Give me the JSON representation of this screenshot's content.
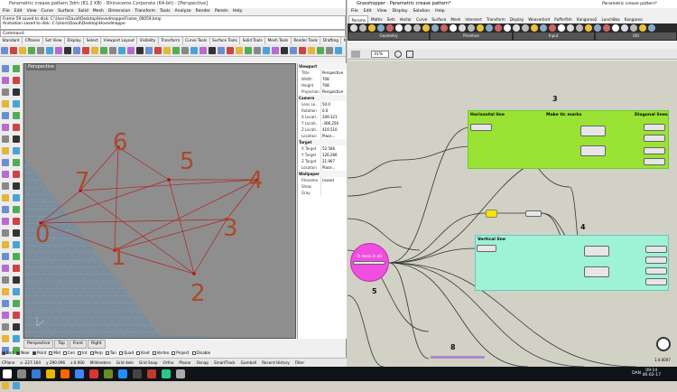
{
  "rhino": {
    "title": "Parametric crease pattern.3dm (81.2 KB) - Rhinoceros Corporate (64-bit) - [Perspective]",
    "menu": [
      "File",
      "Edit",
      "View",
      "Curve",
      "Surface",
      "Solid",
      "Mesh",
      "Dimension",
      "Transform",
      "Tools",
      "Analyze",
      "Render",
      "Panels",
      "Help"
    ],
    "command_history": [
      "Frame 59 saved to disk: C:\\Users\\David\\Desktop\\Hovedmappe\\Frame_00059.bmp",
      "Animation saved to disk: C:\\Users\\David\\Desktop\\Hovedmappe"
    ],
    "command_prompt": "Command:",
    "toolbar_tabs": [
      "Standard",
      "CPlanes",
      "Set View",
      "Display",
      "Select",
      "Viewport Layout",
      "Visibility",
      "Transform",
      "Curve Tools",
      "Surface Tools",
      "Solid Tools",
      "Mesh Tools",
      "Render Tools",
      "Drafting",
      "New in V6"
    ],
    "viewport_label": "Perspective",
    "point_labels": [
      "0",
      "1",
      "2",
      "3",
      "4",
      "5",
      "6",
      "7"
    ],
    "viewport_tabs": [
      "Perspective",
      "Top",
      "Front",
      "Right"
    ],
    "properties": {
      "viewport_header": "Viewport",
      "viewport_rows": [
        {
          "k": "Title",
          "v": "Perspective"
        },
        {
          "k": "Width",
          "v": "708"
        },
        {
          "k": "Height",
          "v": "708"
        },
        {
          "k": "Projection",
          "v": "Perspective"
        }
      ],
      "camera_header": "Camera",
      "camera_rows": [
        {
          "k": "Lens Le..",
          "v": "50.0"
        },
        {
          "k": "Rotation",
          "v": "0.0"
        },
        {
          "k": "X Locati..",
          "v": "349.321"
        },
        {
          "k": "Y Locati..",
          "v": "-306.256"
        },
        {
          "k": "Z Locati..",
          "v": "419.510"
        },
        {
          "k": "Location",
          "v": "Place..."
        }
      ],
      "target_header": "Target",
      "target_rows": [
        {
          "k": "X Target",
          "v": "52.566"
        },
        {
          "k": "Y Target",
          "v": "126.266"
        },
        {
          "k": "Z Target",
          "v": "21.907"
        },
        {
          "k": "Location",
          "v": "Place..."
        }
      ],
      "wallpaper_header": "Wallpaper",
      "wallpaper_rows": [
        {
          "k": "Filename",
          "v": "(none)"
        },
        {
          "k": "Show",
          "v": ""
        },
        {
          "k": "Gray",
          "v": ""
        }
      ]
    },
    "osnaps": [
      "End",
      "Near",
      "Point",
      "Mid",
      "Cen",
      "Int",
      "Perp",
      "Tan",
      "Quad",
      "Knot",
      "Vertex",
      "Project",
      "Disable"
    ],
    "status": [
      "CPlane",
      "x -227.164",
      "y 290.096",
      "z 0.000",
      "Millimeters",
      "Grid dele",
      "Grid Snap",
      "Ortho",
      "Planar",
      "Osnap",
      "SmartTrack",
      "Gumball",
      "Record History",
      "Filter"
    ]
  },
  "grasshopper": {
    "title": "Grasshopper - Parametric crease pattern*",
    "doc_name": "Parametric crease pattern*",
    "menu": [
      "File",
      "Edit",
      "View",
      "Display",
      "Solution",
      "Help"
    ],
    "tabs": [
      "Params",
      "Maths",
      "Sets",
      "Vector",
      "Curve",
      "Surface",
      "Mesh",
      "Intersect",
      "Transform",
      "Display",
      "Weaverbird",
      "Pufferfish",
      "Kangaroo2",
      "LunchBox",
      "Kangaroo"
    ],
    "ribbon_groups": [
      "Geometry",
      "Primitive",
      "Input",
      "Util"
    ],
    "zoom": "31%",
    "groups": {
      "horizontal": "Horizontal line",
      "tic_marks": "Make tic marks",
      "diagonal": "Diagonal lines",
      "vertical": "Vertical line",
      "it_does_it_all": "It does it all"
    },
    "numbers": [
      "3",
      "4",
      "5",
      "8"
    ],
    "version": "1.0.0007"
  },
  "taskbar": {
    "time": "09:14",
    "date": "06-02-17",
    "lang": "DAN"
  }
}
